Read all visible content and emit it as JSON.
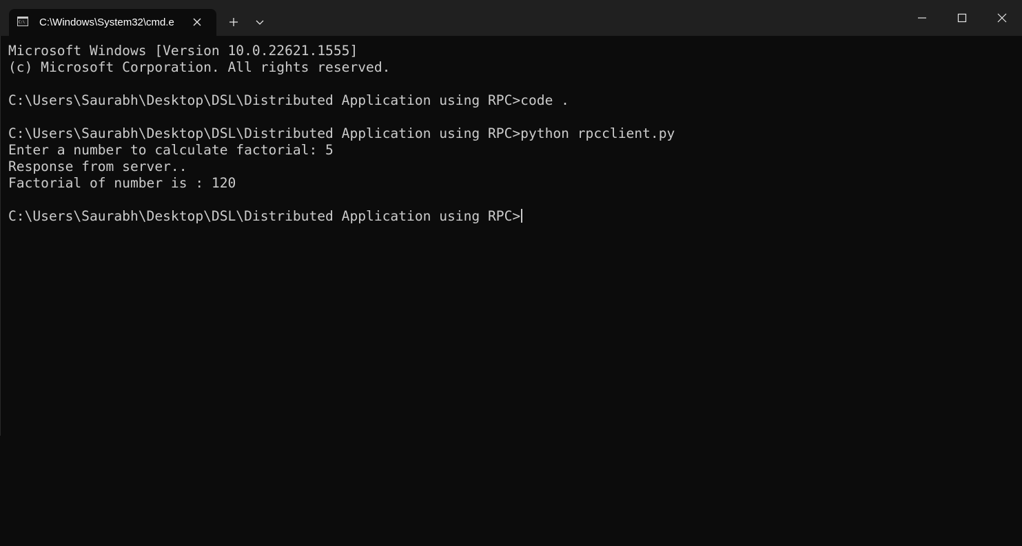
{
  "window": {
    "tab_title": "C:\\Windows\\System32\\cmd.e",
    "tab_icon": "console-icon",
    "close_tab_icon": "close-icon",
    "new_tab_icon": "plus-icon",
    "tab_menu_icon": "chevron-down-icon",
    "minimize_icon": "minimize-icon",
    "maximize_icon": "maximize-icon",
    "close_window_icon": "close-icon"
  },
  "terminal": {
    "lines": [
      "Microsoft Windows [Version 10.0.22621.1555]",
      "(c) Microsoft Corporation. All rights reserved.",
      "",
      "C:\\Users\\Saurabh\\Desktop\\DSL\\Distributed Application using RPC>code .",
      "",
      "C:\\Users\\Saurabh\\Desktop\\DSL\\Distributed Application using RPC>python rpcclient.py",
      "Enter a number to calculate factorial: 5",
      "Response from server..",
      "Factorial of number is : 120",
      "",
      "C:\\Users\\Saurabh\\Desktop\\DSL\\Distributed Application using RPC>"
    ]
  },
  "colors": {
    "background": "#0c0c0c",
    "titlebar": "#202020",
    "text": "#cccccc"
  }
}
